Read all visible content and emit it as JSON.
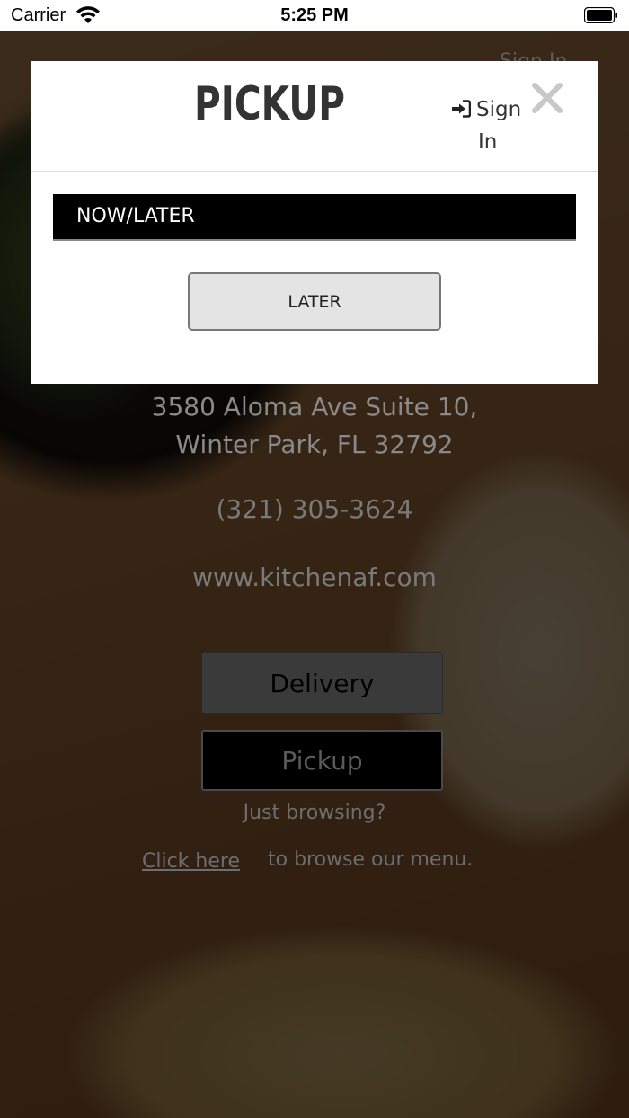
{
  "status_bar": {
    "carrier": "Carrier",
    "time": "5:25 PM"
  },
  "background": {
    "signin_text": "Sign In",
    "address_line1": "3580 Aloma Ave Suite 10,",
    "address_line2": "Winter Park, FL 32792",
    "phone": "(321) 305-3624",
    "website": "www.kitchenaf.com",
    "delivery_label": "Delivery",
    "pickup_label": "Pickup",
    "browsing_text": "Just browsing?",
    "click_here": "Click here",
    "browse_menu_text": "to browse our menu."
  },
  "modal": {
    "title": "PICKUP",
    "signin_line1": "Sign",
    "signin_line2": "In",
    "now_later_label": "NOW/LATER",
    "later_button": "LATER"
  },
  "icons": {
    "signin": "sign-in-icon",
    "close": "close-icon",
    "wifi": "wifi-icon",
    "battery": "battery-icon"
  },
  "colors": {
    "modal_bg": "#ffffff",
    "title": "#333333",
    "bar": "#000000",
    "button_bg": "#e4e4e4"
  }
}
